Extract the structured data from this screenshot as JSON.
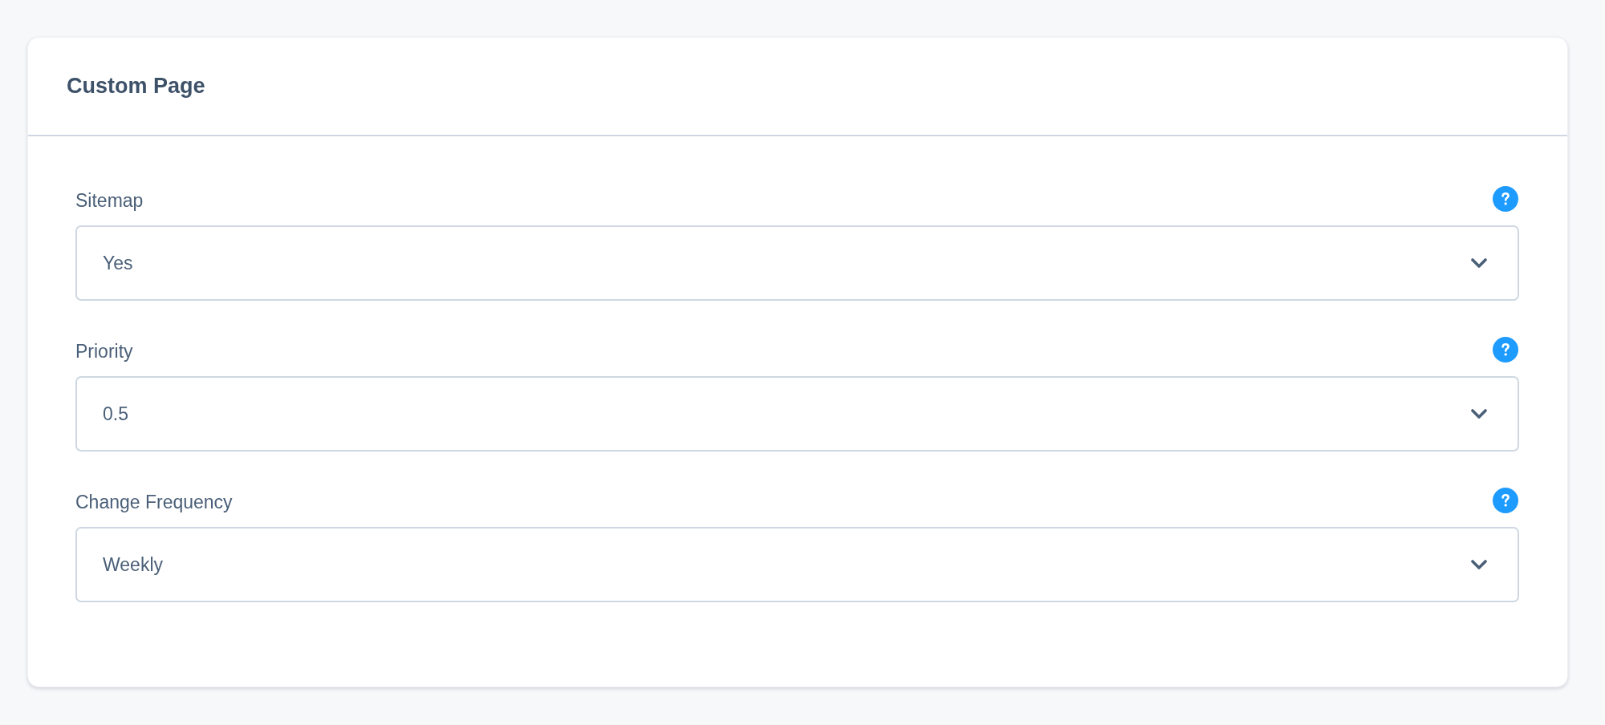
{
  "card": {
    "title": "Custom Page"
  },
  "fields": [
    {
      "label": "Sitemap",
      "value": "Yes"
    },
    {
      "label": "Priority",
      "value": "0.5"
    },
    {
      "label": "Change Frequency",
      "value": "Weekly"
    }
  ]
}
